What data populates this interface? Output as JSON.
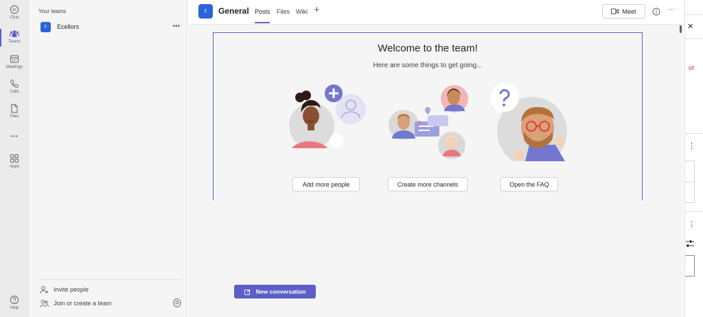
{
  "rail": {
    "items": [
      {
        "label": "Chat",
        "icon": "chat-icon"
      },
      {
        "label": "Teams",
        "icon": "teams-icon",
        "active": true
      },
      {
        "label": "Meetings",
        "icon": "calendar-icon"
      },
      {
        "label": "Calls",
        "icon": "phone-icon"
      },
      {
        "label": "Files",
        "icon": "file-icon"
      },
      {
        "label": "Apps",
        "icon": "apps-icon"
      },
      {
        "label": "Help",
        "icon": "help-icon"
      }
    ],
    "more": "•••"
  },
  "panel": {
    "heading": "Your teams",
    "team": {
      "avatar": "E",
      "name": "Ecellors",
      "more": "•••"
    },
    "invite": "Invite people",
    "join": "Join or create a team"
  },
  "channel": {
    "avatar": "E",
    "name": "General",
    "tabs": [
      "Posts",
      "Files",
      "Wiki"
    ],
    "add_tab": "+",
    "meet": "Meet",
    "more": "···"
  },
  "welcome": {
    "title": "Welcome to the team!",
    "subtitle": "Here are some things to get going...",
    "buttons": [
      "Add more people",
      "Create more channels",
      "Open the FAQ"
    ]
  },
  "new_conversation": "New conversation",
  "right_strip": {
    "close": "✕",
    "fragment": "of",
    "more1": "⋮",
    "more2": "⋮"
  },
  "colors": {
    "accent": "#5b5fc7",
    "team_blue": "#2b63d9"
  }
}
